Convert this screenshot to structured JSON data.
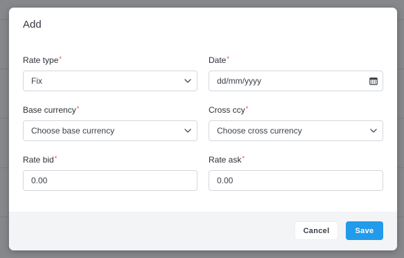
{
  "modal": {
    "title": "Add",
    "required_mark": "*"
  },
  "fields": {
    "rate_type": {
      "label": "Rate type",
      "value": "Fix"
    },
    "date": {
      "label": "Date",
      "placeholder": "dd/mm/yyyy"
    },
    "base_currency": {
      "label": "Base currency",
      "value": "Choose base currency"
    },
    "cross_ccy": {
      "label": "Cross ccy",
      "value": "Choose cross currency"
    },
    "rate_bid": {
      "label": "Rate bid",
      "value": "0.00"
    },
    "rate_ask": {
      "label": "Rate ask",
      "value": "0.00"
    }
  },
  "footer": {
    "cancel_label": "Cancel",
    "save_label": "Save"
  },
  "colors": {
    "primary": "#229bea",
    "required": "#e0443c",
    "backdrop": "#86888c"
  },
  "icons": {
    "select_chevron": "chevron-down-icon",
    "date_picker": "calendar-icon"
  }
}
